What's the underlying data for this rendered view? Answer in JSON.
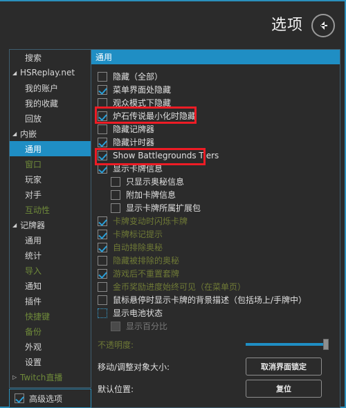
{
  "header": {
    "title": "选项",
    "back_icon": "arrow-left-icon"
  },
  "sidebar": {
    "items": [
      {
        "label": "搜索",
        "level": 1,
        "arrow": "",
        "selected": false,
        "style": "normal"
      },
      {
        "label": "HSReplay.net",
        "level": 0,
        "arrow": "◢",
        "selected": false,
        "style": "normal"
      },
      {
        "label": "我的账户",
        "level": 1,
        "arrow": "",
        "selected": false,
        "style": "normal"
      },
      {
        "label": "我的收藏",
        "level": 1,
        "arrow": "",
        "selected": false,
        "style": "normal"
      },
      {
        "label": "回放",
        "level": 1,
        "arrow": "",
        "selected": false,
        "style": "normal"
      },
      {
        "label": "内嵌",
        "level": 0,
        "arrow": "◢",
        "selected": false,
        "style": "normal"
      },
      {
        "label": "通用",
        "level": 1,
        "arrow": "",
        "selected": true,
        "style": "normal"
      },
      {
        "label": "窗口",
        "level": 1,
        "arrow": "",
        "selected": false,
        "style": "green"
      },
      {
        "label": "玩家",
        "level": 1,
        "arrow": "",
        "selected": false,
        "style": "normal"
      },
      {
        "label": "对手",
        "level": 1,
        "arrow": "",
        "selected": false,
        "style": "normal"
      },
      {
        "label": "互动性",
        "level": 1,
        "arrow": "",
        "selected": false,
        "style": "green"
      },
      {
        "label": "记牌器",
        "level": 0,
        "arrow": "◢",
        "selected": false,
        "style": "normal"
      },
      {
        "label": "通用",
        "level": 1,
        "arrow": "",
        "selected": false,
        "style": "normal"
      },
      {
        "label": "统计",
        "level": 1,
        "arrow": "",
        "selected": false,
        "style": "normal"
      },
      {
        "label": "导入",
        "level": 1,
        "arrow": "",
        "selected": false,
        "style": "green"
      },
      {
        "label": "通知",
        "level": 1,
        "arrow": "",
        "selected": false,
        "style": "normal"
      },
      {
        "label": "插件",
        "level": 1,
        "arrow": "",
        "selected": false,
        "style": "normal"
      },
      {
        "label": "快捷键",
        "level": 1,
        "arrow": "",
        "selected": false,
        "style": "green"
      },
      {
        "label": "备份",
        "level": 1,
        "arrow": "",
        "selected": false,
        "style": "green"
      },
      {
        "label": "外观",
        "level": 1,
        "arrow": "",
        "selected": false,
        "style": "normal"
      },
      {
        "label": "设置",
        "level": 1,
        "arrow": "",
        "selected": false,
        "style": "normal"
      },
      {
        "label": "Twitch直播",
        "level": 0,
        "arrow": "▷",
        "selected": false,
        "style": "green"
      }
    ],
    "advanced": {
      "label": "高级选项",
      "checked": true
    }
  },
  "content": {
    "tab_label": "通用",
    "options": [
      {
        "label": "隐藏（全部）",
        "checked": false,
        "indent": false,
        "style": "normal",
        "state": "normal"
      },
      {
        "label": "菜单界面处隐藏",
        "checked": true,
        "indent": false,
        "style": "normal",
        "state": "normal"
      },
      {
        "label": "观众模式下隐藏",
        "checked": false,
        "indent": false,
        "style": "normal",
        "state": "normal"
      },
      {
        "label": "炉石传说最小化时隐藏",
        "checked": true,
        "indent": false,
        "style": "normal",
        "state": "normal"
      },
      {
        "label": "隐藏记牌器",
        "checked": false,
        "indent": false,
        "style": "normal",
        "state": "normal"
      },
      {
        "label": "隐藏计时器",
        "checked": true,
        "indent": false,
        "style": "normal",
        "state": "normal"
      },
      {
        "label": "Show Battlegrounds Tiers",
        "checked": true,
        "indent": false,
        "style": "normal",
        "state": "normal"
      },
      {
        "label": "显示卡牌信息",
        "checked": true,
        "indent": false,
        "style": "normal",
        "state": "normal"
      },
      {
        "label": "只显示奥秘信息",
        "checked": false,
        "indent": true,
        "style": "normal",
        "state": "normal"
      },
      {
        "label": "附加卡牌信息",
        "checked": false,
        "indent": true,
        "style": "normal",
        "state": "normal"
      },
      {
        "label": "显示卡牌所属扩展包",
        "checked": false,
        "indent": true,
        "style": "normal",
        "state": "normal"
      },
      {
        "label": "卡牌变动时闪烁卡牌",
        "checked": true,
        "indent": false,
        "style": "olive",
        "state": "normal"
      },
      {
        "label": "卡牌标记提示",
        "checked": true,
        "indent": false,
        "style": "olive",
        "state": "normal"
      },
      {
        "label": "自动排除奥秘",
        "checked": true,
        "indent": false,
        "style": "olive",
        "state": "normal"
      },
      {
        "label": "隐藏被排除的奥秘",
        "checked": false,
        "indent": false,
        "style": "olive",
        "state": "normal"
      },
      {
        "label": "游戏后不重置套牌",
        "checked": true,
        "indent": false,
        "style": "olive",
        "state": "normal"
      },
      {
        "label": "金币奖励进度始终可见（在菜单页）",
        "checked": false,
        "indent": false,
        "style": "olive",
        "state": "normal"
      },
      {
        "label": "鼠标悬停时显示卡牌的背景描述（包括场上/手牌中）",
        "checked": false,
        "indent": false,
        "style": "normal",
        "state": "normal"
      },
      {
        "label": "显示电池状态",
        "checked": false,
        "indent": false,
        "style": "normal",
        "state": "focus"
      },
      {
        "label": "显示百分比",
        "checked": false,
        "indent": true,
        "style": "dim",
        "state": "disabled"
      }
    ],
    "opacity": {
      "label": "不透明度:",
      "value": 100
    },
    "move_resize": {
      "label": "移动/调整对象大小:",
      "button": "取消界面锁定"
    },
    "default_position": {
      "label": "默认位置:",
      "button": "复位"
    }
  },
  "highlights": [
    {
      "target": "炉石传说最小化时隐藏",
      "color": "#ee1c25"
    },
    {
      "target": "Show Battlegrounds Tiers",
      "color": "#ee1c25"
    }
  ]
}
